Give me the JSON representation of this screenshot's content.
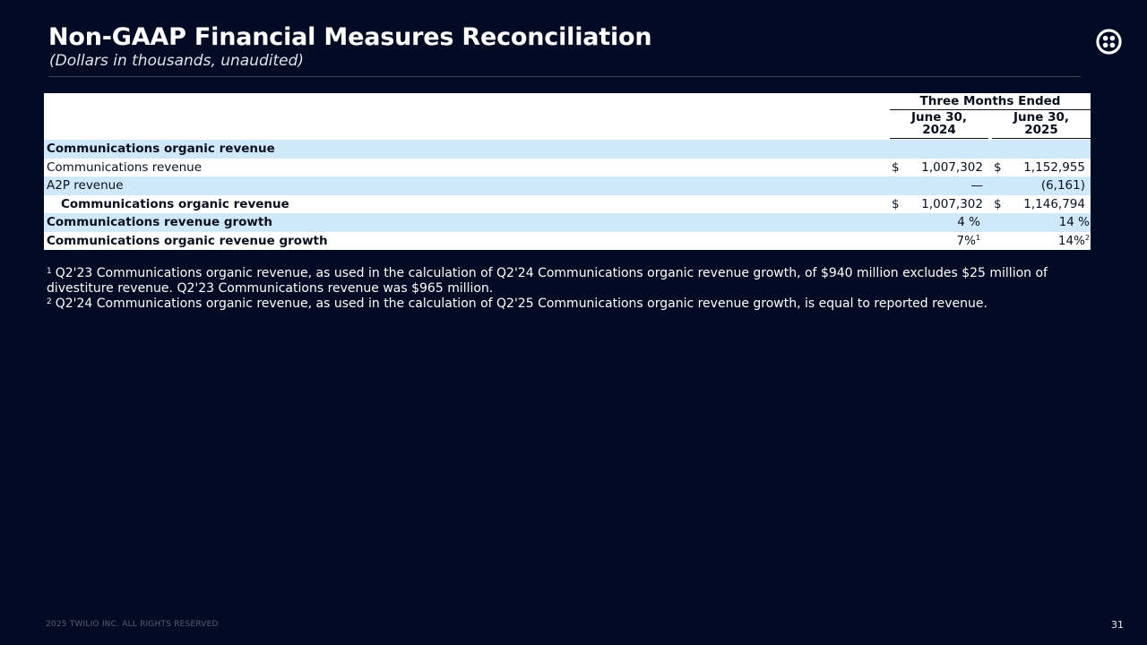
{
  "header": {
    "title": "Non-GAAP Financial Measures Reconciliation",
    "subtitle": "(Dollars in thousands, unaudited)"
  },
  "logo": {
    "icon": "twilio-logo-icon"
  },
  "table": {
    "period_header": "Three Months Ended",
    "columns": [
      "June 30,\n2024",
      "June 30,\n2025"
    ],
    "rows": [
      {
        "label": "Communications organic revenue",
        "style": "section",
        "v1": "",
        "v2": "",
        "cur1": "",
        "cur2": ""
      },
      {
        "label": "Communications revenue",
        "style": "normal",
        "cur1": "$",
        "v1": "1,007,302",
        "cur2": "$",
        "v2": "1,152,955"
      },
      {
        "label": "A2P revenue",
        "style": "normal",
        "cur1": "",
        "v1": "—",
        "cur2": "",
        "v2": "(6,161)"
      },
      {
        "label": "Communications organic revenue",
        "style": "total",
        "cur1": "$",
        "v1": "1,007,302",
        "cur2": "$",
        "v2": "1,146,794"
      },
      {
        "label": "Communications revenue growth",
        "style": "bold",
        "cur1": "",
        "v1": "4 %",
        "cur2": "",
        "v2": "14 %"
      },
      {
        "label": "Communications organic revenue growth",
        "style": "bold",
        "cur1": "",
        "v1": "7%",
        "sup1": "1",
        "cur2": "",
        "v2": "14%",
        "sup2": "2"
      }
    ]
  },
  "footnotes": [
    {
      "marker": "1",
      "text": "Q2'23 Communications organic revenue, as used in the calculation of Q2'24 Communications organic revenue growth, of $940 million excludes $25 million of divestiture revenue. Q2'23 Communications revenue was $965 million."
    },
    {
      "marker": "2",
      "text": "Q2'24 Communications organic revenue, as used in the calculation of Q2'25 Communications organic revenue growth, is equal to reported revenue."
    }
  ],
  "footer": {
    "copyright": "2025 TWILIO INC. ALL RIGHTS RESERVED",
    "page_number": "31"
  }
}
